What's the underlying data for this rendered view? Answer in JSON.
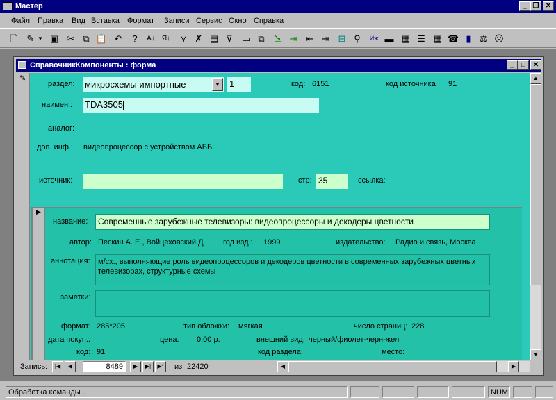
{
  "app": {
    "title": "Мастер"
  },
  "menu": [
    "Файл",
    "Правка",
    "Вид",
    "Вставка",
    "Формат",
    "Записи",
    "Сервис",
    "Окно",
    "Справка"
  ],
  "toolbar_icons": [
    "view-icon",
    "design-icon",
    "dropdown-icon",
    "save-icon",
    "cut-icon",
    "copy-icon",
    "paste-icon",
    "undo-icon",
    "help-icon",
    "sort-asc-icon",
    "sort-desc-icon",
    "filter-selection-icon",
    "filter-form-icon",
    "apply-filter-icon",
    "filter-icon",
    "new-window-icon",
    "cascade-icon",
    "import-icon",
    "export-icon",
    "arrow-left-icon",
    "arrow-right-icon",
    "record-icon",
    "find-icon",
    "table-icon",
    "field-icon",
    "ruler-icon",
    "book-icon",
    "calculator-icon",
    "phone-icon",
    "book2-icon",
    "scales-icon",
    "face-icon"
  ],
  "form": {
    "window_title": "СправочникКомпоненты : форма",
    "razdel_label": "раздел:",
    "razdel_value": "микросхемы импортные",
    "razdel_num": "1",
    "kod_label": "код:",
    "kod_value": "6151",
    "kod_src_label": "код источника",
    "kod_src_value": "91",
    "naim_label": "наимен.:",
    "naim_value": "TDA3505",
    "analog_label": "аналог:",
    "dopinf_label": "доп. инф.:",
    "dopinf_value": "видеопроцессор с устройством АББ",
    "istochnik_label": "источник:",
    "istochnik_value": "",
    "str_label": "стр:",
    "str_value": "35",
    "ssylka_label": "ссылка:"
  },
  "subform": {
    "nazvanie_label": "название:",
    "nazvanie_value": "Современные зарубежные телевизоры: видеопроцессоры и декодеры цветности",
    "avtor_label": "автор:",
    "avtor_value": "Пескин А. Е., Войцеховский Д",
    "god_label": "год изд.:",
    "god_value": "1999",
    "izd_label": "издательство:",
    "izd_value": "Радио и связь, Москва",
    "annot_label": "аннотация:",
    "annot_value": "м/сх., выполняющие роль видеопроцессоров и декодеров цветности в современных зарубежных цветных телевизорах, структурные схемы",
    "zametki_label": "заметки:",
    "zametki_value": "",
    "format_label": "формат:",
    "format_value": "285*205",
    "oblozh_label": "тип обложки:",
    "oblozh_value": "мягкая",
    "pages_label": "число страниц:",
    "pages_value": "228",
    "datapok_label": "дата покуп.:",
    "cena_label": "цена:",
    "cena_value": "0,00 р.",
    "vid_label": "внешний вид:",
    "vid_value": "черный/фиолет-черн-жел",
    "kod_label": "код:",
    "kod_value": "91",
    "kodrazd_label": "код раздела:",
    "mesto_label": "место:"
  },
  "record_nav": {
    "label": "Запись:",
    "current": "8489",
    "of_label": "из",
    "total": "22420"
  },
  "status": {
    "text": "Обработка команды . . .",
    "num": "NUM"
  }
}
